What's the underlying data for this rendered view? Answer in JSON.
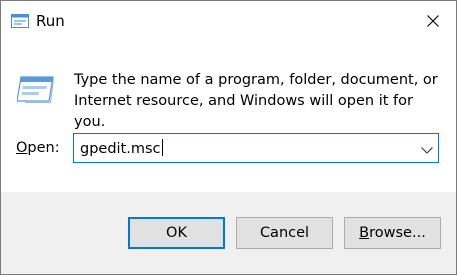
{
  "window": {
    "title": "Run",
    "title_icon": "run-dialog-icon",
    "close_icon": "close-icon"
  },
  "main": {
    "icon": "run-program-icon",
    "description": "Type the name of a program, folder, document, or Internet resource, and Windows will open it for you.",
    "open_label_prefix": "",
    "open_label_mnemonic": "O",
    "open_label_rest": "pen:",
    "open_value": "gpedit.msc"
  },
  "buttons": {
    "ok": "OK",
    "cancel": "Cancel",
    "browse_mnemonic": "B",
    "browse_rest": "rowse..."
  },
  "colors": {
    "accent": "#0078d7",
    "footer_bg": "#f0f0f0",
    "button_bg": "#e1e1e1"
  }
}
